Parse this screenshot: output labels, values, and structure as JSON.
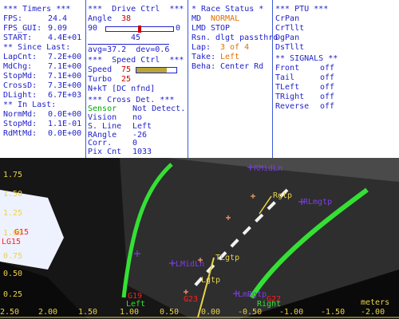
{
  "timers": {
    "header": "*** Timers ***",
    "fps_label": "FPS:",
    "fps_value": "24.4",
    "fps_gui_label": "FPS_GUI:",
    "fps_gui_value": "9.09",
    "start_label": "START:",
    "start_value": "4.4E+01",
    "since_header": "** Since Last:",
    "lapcnt_label": "LapCnt:",
    "lapcnt_value": "7.2E+00",
    "mdchg_label": "MdChg:",
    "mdchg_value": "7.1E+00",
    "stopmd_label": "StopMd:",
    "stopmd_value": "7.1E+00",
    "crossd_label": "CrossD:",
    "crossd_value": "7.3E+00",
    "dlight_label": "DLight:",
    "dlight_value": "6.7E+03",
    "inlast_header": "** In Last:",
    "normmd_label": "NormMd:",
    "normmd_value": "0.0E+00",
    "stopmd2_label": "StopMd:",
    "stopmd2_value": "1.1E-01",
    "rdmtmd_label": "RdMtMd:",
    "rdmtmd_value": "0.0E+00"
  },
  "drive": {
    "header": "***  Drive Ctrl  ***",
    "angle_label": "Angle",
    "angle_value": "38",
    "slider_min": "90",
    "slider_max": "0",
    "slider_value": "45",
    "slider_fraction": 0.5,
    "avg_text": "avg=37.2  dev=0.6"
  },
  "speed": {
    "header": "***  Speed Ctrl  ***",
    "speed_label": "Speed",
    "speed_value": "75",
    "speed_fraction": 0.75,
    "turbo_label": "Turbo",
    "turbo_value": "25",
    "nkt_text": "N+kT [DC nfnd]"
  },
  "cross": {
    "header": "*** Cross Det. ***",
    "sensor_label": "Sensor",
    "sensor_value": "Not Detect.",
    "vision_label": "Vision",
    "vision_value": "no",
    "sline_label": "S. Line",
    "sline_value": "Left",
    "rangle_label": "RAngle",
    "rangle_value": "-26",
    "corr_label": "Corr.",
    "corr_value": "0",
    "pix_label": "Pix Cnt",
    "pix_value": "1033"
  },
  "race": {
    "header": "* Race Status *",
    "md_label": "MD",
    "md_value": "NORMAL",
    "lmd_label": "LMD",
    "lmd_value": "STOP",
    "rsn_label": "Rsn.",
    "rsn_value": "dlgt passthro",
    "lap_label": "Lap:",
    "lap_value": "3 of 4",
    "take_label": "Take:",
    "take_value": "Left",
    "beha_label": "Beha:",
    "beha_value": "Center Rd"
  },
  "ptu": {
    "header": "*** PTU ***",
    "items": [
      "CrPan",
      "CrTllt",
      "DgPan",
      "DsTllt"
    ]
  },
  "signals": {
    "header": "** SIGNALS **",
    "front_label": "Front",
    "front_value": "off",
    "tail_label": "Tail",
    "tail_value": "off",
    "tleft_label": "TLeft",
    "tleft_value": "off",
    "tright_label": "TRight",
    "tright_value": "off",
    "reverse_label": "Reverse",
    "reverse_value": "off"
  },
  "camera": {
    "y_ticks": [
      "1.75",
      "1.50",
      "1.25",
      "1.00",
      "0.75",
      "0.50",
      "0.25"
    ],
    "x_ticks": [
      "2.00",
      "1.50",
      "1.00",
      "0.50",
      "0.00",
      "-0.50",
      "-1.00",
      "-1.50",
      "-2.00"
    ],
    "x_ticks_left": [
      "2.50",
      "2.00",
      "1.50"
    ],
    "units": "meters",
    "labels": {
      "left_g15": "G15",
      "left_g": "LG15",
      "g19": "G19",
      "left_bottom": "Left",
      "right_bottom": "Right",
      "rmidl": "RMidLn",
      "rgtp": "Rgtp",
      "rlmgtp": "RLmgtp",
      "lmdln": "LMidLn",
      "tlgtp": "TLgtp",
      "lgtp": "Lgtp",
      "lmgtp": "LmRgtp",
      "g23": "G23",
      "g22": "G22"
    },
    "colors": {
      "lane": "#35e035",
      "marker": "#7b3fe4",
      "cross": "#ff9a6b",
      "axis": "#e8d34a"
    }
  }
}
